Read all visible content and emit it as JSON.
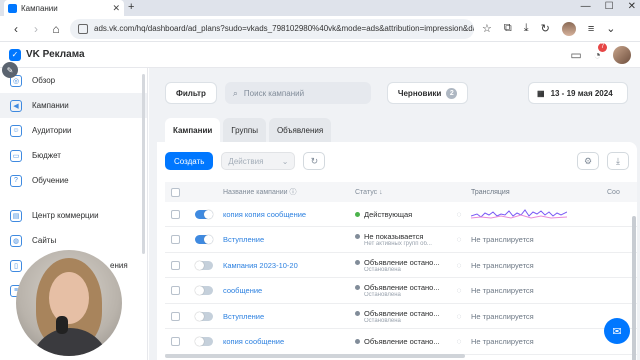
{
  "browser": {
    "tab_title": "Кампании",
    "new_tab": "+",
    "url": "ads.vk.com/hq/dashboard/ad_plans?sudo=vkads_798102980%40vk&mode=ads&attribution=impression&date_frc"
  },
  "app": {
    "brand": "VK Реклама",
    "notifications_count": "7"
  },
  "sidebar": {
    "items": [
      {
        "label": "Обзор",
        "icon": "compass-icon"
      },
      {
        "label": "Кампании",
        "icon": "megaphone-icon"
      },
      {
        "label": "Аудитории",
        "icon": "users-icon"
      },
      {
        "label": "Бюджет",
        "icon": "wallet-icon"
      },
      {
        "label": "Обучение",
        "icon": "help-icon"
      },
      {
        "label": "Центр коммерции",
        "icon": "cart-icon"
      },
      {
        "label": "Сайты",
        "icon": "globe-icon"
      },
      {
        "label": "",
        "icon": "phone-icon"
      },
      {
        "label": "",
        "icon": "list-icon"
      }
    ],
    "partial_label": "ения"
  },
  "toolbar": {
    "filter_label": "Фильтр",
    "search_placeholder": "Поиск кампаний",
    "drafts_label": "Черновики",
    "drafts_count": "2",
    "date_range": "13 - 19 мая 2024"
  },
  "tabs": [
    "Кампании",
    "Группы",
    "Объявления"
  ],
  "actions": {
    "create_label": "Создать",
    "actions_placeholder": "Действия"
  },
  "table": {
    "headers": {
      "name": "Название кампании",
      "status": "Статус ↓",
      "translation": "Трансляция",
      "extra": "Coo"
    },
    "rows": [
      {
        "name": "копия копия сообщение",
        "toggle": true,
        "status": "Действующая",
        "status_color": "#4bb34b",
        "sub": "",
        "translation": ""
      },
      {
        "name": "Вступление",
        "toggle": true,
        "status": "Не показывается",
        "status_color": "#818c99",
        "sub": "Нет активных групп об...",
        "translation": "Не транслируется"
      },
      {
        "name": "Кампания 2023-10-20",
        "toggle": false,
        "status": "Объявление остано...",
        "status_color": "#818c99",
        "sub": "Остановлена",
        "translation": "Не транслируется"
      },
      {
        "name": "сообщение",
        "toggle": false,
        "status": "Объявление остано...",
        "status_color": "#818c99",
        "sub": "Остановлена",
        "translation": "Не транслируется"
      },
      {
        "name": "Вступление",
        "toggle": false,
        "status": "Объявление остано...",
        "status_color": "#818c99",
        "sub": "Остановлена",
        "translation": "Не транслируется"
      },
      {
        "name": "копия сообщение",
        "toggle": false,
        "status": "Объявление остано...",
        "status_color": "#818c99",
        "sub": "",
        "translation": "Не транслируется"
      }
    ]
  },
  "colors": {
    "accent": "#0077ff",
    "link": "#2d81e0",
    "active_status": "#4bb34b"
  }
}
